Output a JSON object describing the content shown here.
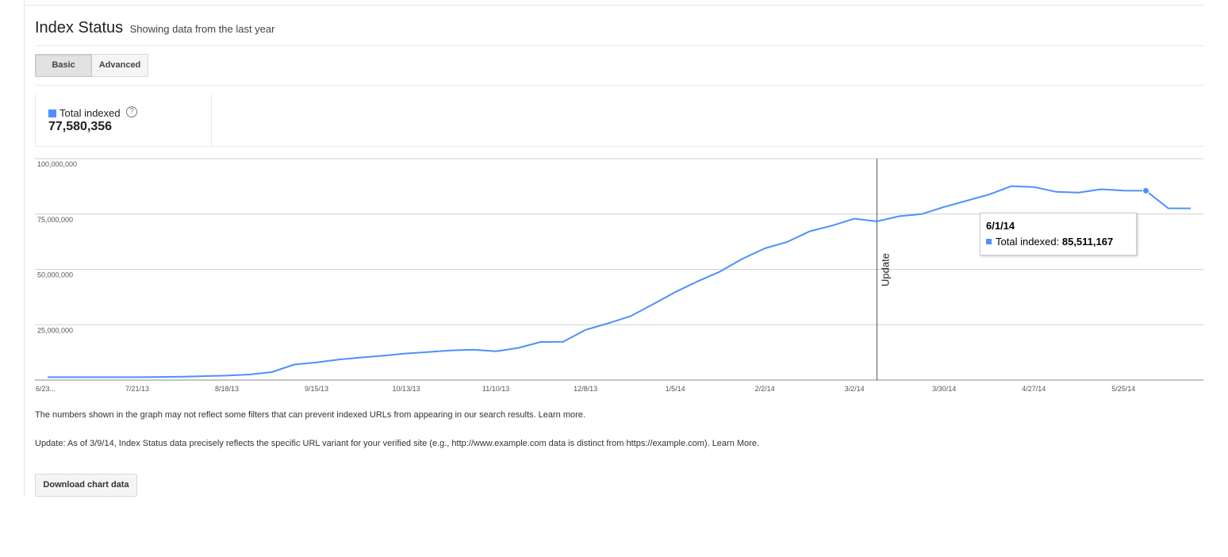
{
  "header": {
    "title": "Index Status",
    "subtitle": "Showing data from the last year"
  },
  "tabs": [
    {
      "label": "Basic",
      "active": true
    },
    {
      "label": "Advanced",
      "active": false
    }
  ],
  "metric": {
    "label": "Total indexed",
    "help_icon": "question-circle-icon",
    "value": "77,580,356",
    "color": "#4d90fe"
  },
  "chart_data": {
    "type": "line",
    "series": [
      {
        "name": "Total indexed",
        "color": "#4d90fe",
        "x": [
          "6/23/13",
          "6/30/13",
          "7/7/13",
          "7/14/13",
          "7/21/13",
          "7/28/13",
          "8/4/13",
          "8/11/13",
          "8/18/13",
          "8/25/13",
          "9/1/13",
          "9/8/13",
          "9/15/13",
          "9/22/13",
          "9/29/13",
          "10/6/13",
          "10/13/13",
          "10/20/13",
          "10/27/13",
          "11/3/13",
          "11/10/13",
          "11/17/13",
          "11/24/13",
          "12/1/13",
          "12/8/13",
          "12/15/13",
          "12/22/13",
          "12/29/13",
          "1/5/14",
          "1/12/14",
          "1/19/14",
          "1/26/14",
          "2/2/14",
          "2/9/14",
          "2/16/14",
          "2/23/14",
          "3/2/14",
          "3/9/14",
          "3/16/14",
          "3/23/14",
          "3/30/14",
          "4/6/14",
          "4/13/14",
          "4/20/14",
          "4/27/14",
          "5/4/14",
          "5/11/14",
          "5/18/14",
          "5/25/14",
          "6/1/14",
          "6/8/14",
          "6/15/14"
        ],
        "values": [
          1300000,
          1300000,
          1300000,
          1300000,
          1300000,
          1400000,
          1500000,
          1800000,
          2000000,
          2500000,
          3600000,
          7000000,
          8000000,
          9300000,
          10200000,
          11000000,
          12000000,
          12700000,
          13400000,
          13700000,
          13000000,
          14500000,
          17200000,
          17300000,
          22700000,
          25600000,
          28800000,
          34200000,
          39700000,
          44600000,
          49000000,
          54800000,
          59500000,
          62400000,
          67200000,
          69800000,
          72900000,
          71700000,
          74000000,
          75000000,
          78200000,
          81000000,
          83800000,
          87600000,
          87200000,
          85000000,
          84700000,
          86200000,
          85600000,
          85511167,
          77600000,
          77580356
        ]
      }
    ],
    "x_ticks": [
      "6/23...",
      "7/21/13",
      "8/18/13",
      "9/15/13",
      "10/13/13",
      "11/10/13",
      "12/8/13",
      "1/5/14",
      "2/2/14",
      "3/2/14",
      "3/30/14",
      "4/27/14",
      "5/25/14"
    ],
    "y_ticks": [
      "100,000,000",
      "75,000,000",
      "50,000,000",
      "25,000,000"
    ],
    "ylim": [
      0,
      100000000
    ],
    "grid": true,
    "annotation": {
      "label": "Update",
      "x": "3/9/14"
    },
    "tooltip": {
      "date": "6/1/14",
      "label": "Total indexed:",
      "value": "85,511,167"
    }
  },
  "notes": {
    "filter_note": "The numbers shown in the graph may not reflect some filters that can prevent indexed URLs from appearing in our search results. Learn more.",
    "update_note": "Update: As of 3/9/14, Index Status data precisely reflects the specific URL variant for your verified site (e.g., http://www.example.com data is distinct from https://example.com). Learn More."
  },
  "download_label": "Download chart data"
}
